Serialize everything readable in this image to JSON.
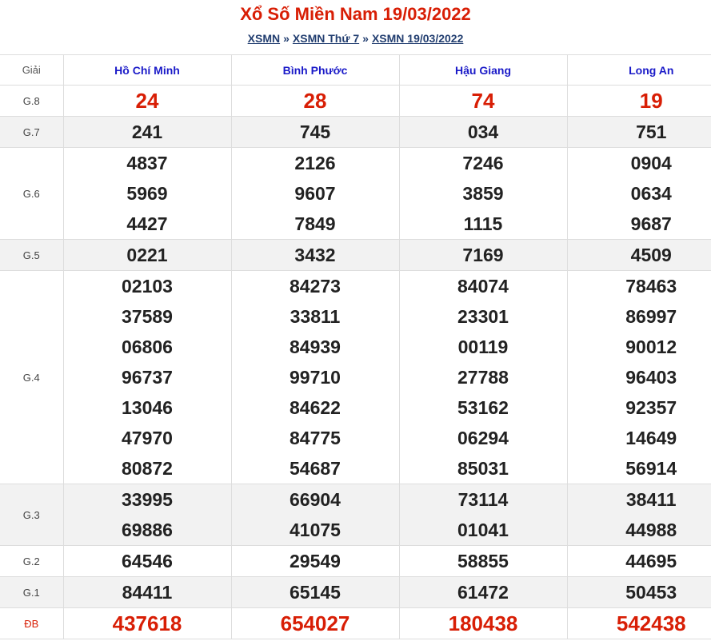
{
  "header": {
    "title": "Xổ Số Miền Nam 19/03/2022",
    "crumbs": [
      "XSMN",
      "XSMN Thứ 7",
      "XSMN 19/03/2022"
    ],
    "separator": "»"
  },
  "table": {
    "label_header": "Giải",
    "provinces": [
      "Hồ Chí Minh",
      "Bình Phước",
      "Hậu Giang",
      "Long An"
    ],
    "prizes": [
      {
        "label": "G.8",
        "style": "big",
        "values": [
          [
            "24"
          ],
          [
            "28"
          ],
          [
            "74"
          ],
          [
            "19"
          ]
        ]
      },
      {
        "label": "G.7",
        "style": "alt",
        "values": [
          [
            "241"
          ],
          [
            "745"
          ],
          [
            "034"
          ],
          [
            "751"
          ]
        ]
      },
      {
        "label": "G.6",
        "style": "plain",
        "values": [
          [
            "4837",
            "5969",
            "4427"
          ],
          [
            "2126",
            "9607",
            "7849"
          ],
          [
            "7246",
            "3859",
            "1115"
          ],
          [
            "0904",
            "0634",
            "9687"
          ]
        ]
      },
      {
        "label": "G.5",
        "style": "alt",
        "values": [
          [
            "0221"
          ],
          [
            "3432"
          ],
          [
            "7169"
          ],
          [
            "4509"
          ]
        ]
      },
      {
        "label": "G.4",
        "style": "plain",
        "values": [
          [
            "02103",
            "37589",
            "06806",
            "96737",
            "13046",
            "47970",
            "80872"
          ],
          [
            "84273",
            "33811",
            "84939",
            "99710",
            "84622",
            "84775",
            "54687"
          ],
          [
            "84074",
            "23301",
            "00119",
            "27788",
            "53162",
            "06294",
            "85031"
          ],
          [
            "78463",
            "86997",
            "90012",
            "96403",
            "92357",
            "14649",
            "56914"
          ]
        ]
      },
      {
        "label": "G.3",
        "style": "alt",
        "values": [
          [
            "33995",
            "69886"
          ],
          [
            "66904",
            "41075"
          ],
          [
            "73114",
            "01041"
          ],
          [
            "38411",
            "44988"
          ]
        ]
      },
      {
        "label": "G.2",
        "style": "plain",
        "values": [
          [
            "64546"
          ],
          [
            "29549"
          ],
          [
            "58855"
          ],
          [
            "44695"
          ]
        ]
      },
      {
        "label": "G.1",
        "style": "alt",
        "values": [
          [
            "84411"
          ],
          [
            "65145"
          ],
          [
            "61472"
          ],
          [
            "50453"
          ]
        ]
      },
      {
        "label": "ĐB",
        "style": "big special",
        "values": [
          [
            "437618"
          ],
          [
            "654027"
          ],
          [
            "180438"
          ],
          [
            "542438"
          ]
        ]
      }
    ]
  }
}
